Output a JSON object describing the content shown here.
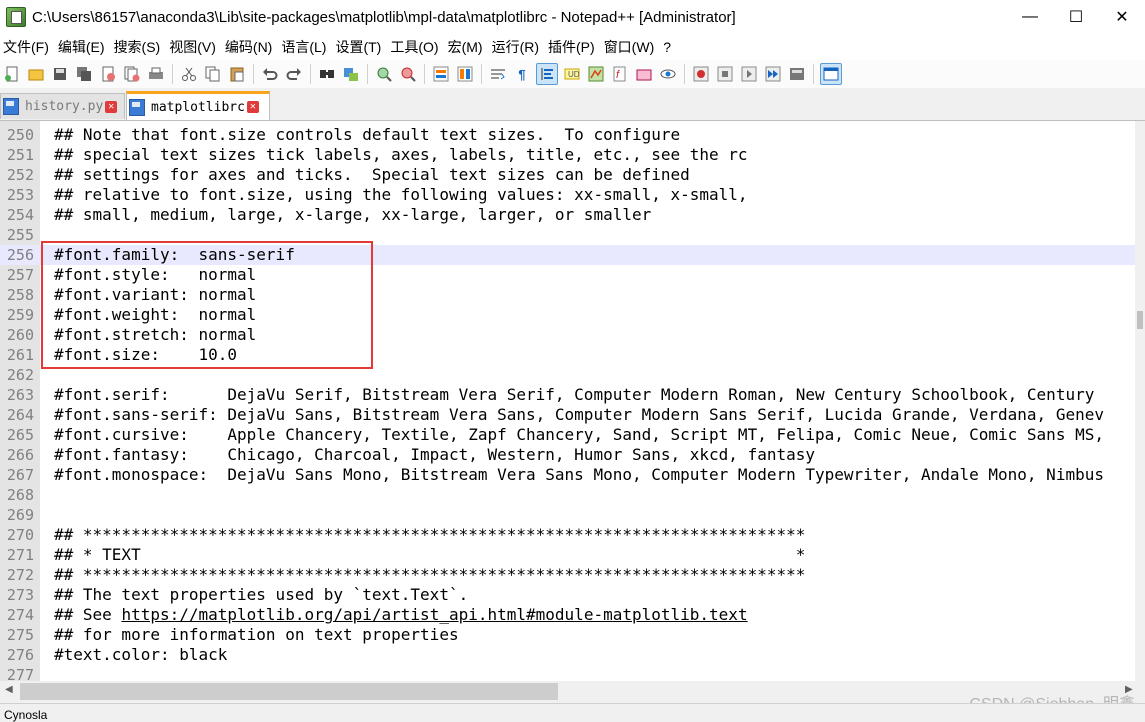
{
  "window": {
    "title": "C:\\Users\\86157\\anaconda3\\Lib\\site-packages\\matplotlib\\mpl-data\\matplotlibrc - Notepad++ [Administrator]",
    "minimize": "—",
    "maximize": "☐",
    "close": "✕"
  },
  "menu": [
    "文件(F)",
    "编辑(E)",
    "搜索(S)",
    "视图(V)",
    "编码(N)",
    "语言(L)",
    "设置(T)",
    "工具(O)",
    "宏(M)",
    "运行(R)",
    "插件(P)",
    "窗口(W)",
    "?"
  ],
  "toolbar": {
    "icons": [
      "new-file-icon",
      "open-file-icon",
      "save-icon",
      "save-all-icon",
      "close-icon",
      "close-all-icon",
      "print-icon",
      "cut-icon",
      "copy-icon",
      "paste-icon",
      "undo-icon",
      "redo-icon",
      "find-icon",
      "replace-icon",
      "zoom-in-icon",
      "zoom-out-icon",
      "sync-vertical-icon",
      "sync-horizontal-icon",
      "word-wrap-icon",
      "show-all-chars-icon",
      "indent-guide-icon",
      "user-defined-language-icon",
      "document-map-icon",
      "function-list-icon",
      "folder-workspace-icon",
      "monitoring-icon",
      "record-macro-icon",
      "stop-record-icon",
      "play-macro-icon",
      "run-macro-multiple-icon",
      "save-macro-icon",
      "panel-icon"
    ]
  },
  "tabs": [
    {
      "label": "history.py",
      "active": false
    },
    {
      "label": "matplotlibrc",
      "active": true
    }
  ],
  "editor": {
    "current_line": 256,
    "lines": [
      {
        "n": "250",
        "t": "## Note that font.size controls default text sizes.  To configure"
      },
      {
        "n": "251",
        "t": "## special text sizes tick labels, axes, labels, title, etc., see the rc"
      },
      {
        "n": "252",
        "t": "## settings for axes and ticks.  Special text sizes can be defined"
      },
      {
        "n": "253",
        "t": "## relative to font.size, using the following values: xx-small, x-small,"
      },
      {
        "n": "254",
        "t": "## small, medium, large, x-large, xx-large, larger, or smaller"
      },
      {
        "n": "255",
        "t": ""
      },
      {
        "n": "256",
        "t": "#font.family:  sans-serif"
      },
      {
        "n": "257",
        "t": "#font.style:   normal"
      },
      {
        "n": "258",
        "t": "#font.variant: normal"
      },
      {
        "n": "259",
        "t": "#font.weight:  normal"
      },
      {
        "n": "260",
        "t": "#font.stretch: normal"
      },
      {
        "n": "261",
        "t": "#font.size:    10.0"
      },
      {
        "n": "262",
        "t": ""
      },
      {
        "n": "263",
        "t": "#font.serif:      DejaVu Serif, Bitstream Vera Serif, Computer Modern Roman, New Century Schoolbook, Century"
      },
      {
        "n": "264",
        "t": "#font.sans-serif: DejaVu Sans, Bitstream Vera Sans, Computer Modern Sans Serif, Lucida Grande, Verdana, Genev"
      },
      {
        "n": "265",
        "t": "#font.cursive:    Apple Chancery, Textile, Zapf Chancery, Sand, Script MT, Felipa, Comic Neue, Comic Sans MS,"
      },
      {
        "n": "266",
        "t": "#font.fantasy:    Chicago, Charcoal, Impact, Western, Humor Sans, xkcd, fantasy"
      },
      {
        "n": "267",
        "t": "#font.monospace:  DejaVu Sans Mono, Bitstream Vera Sans Mono, Computer Modern Typewriter, Andale Mono, Nimbus"
      },
      {
        "n": "268",
        "t": ""
      },
      {
        "n": "269",
        "t": ""
      },
      {
        "n": "270",
        "t": "## ***************************************************************************"
      },
      {
        "n": "271",
        "t": "## * TEXT                                                                    *"
      },
      {
        "n": "272",
        "t": "## ***************************************************************************"
      },
      {
        "n": "273",
        "t": "## The text properties used by `text.Text`."
      },
      {
        "n": "274",
        "t": "## See ",
        "link": "https://matplotlib.org/api/artist_api.html#module-matplotlib.text"
      },
      {
        "n": "275",
        "t": "## for more information on text properties"
      },
      {
        "n": "276",
        "t": "#text.color: black"
      },
      {
        "n": "277",
        "t": ""
      }
    ]
  },
  "status": {
    "text": "Cynosla"
  },
  "watermark": "CSDN @Siobhan. 明鑫"
}
